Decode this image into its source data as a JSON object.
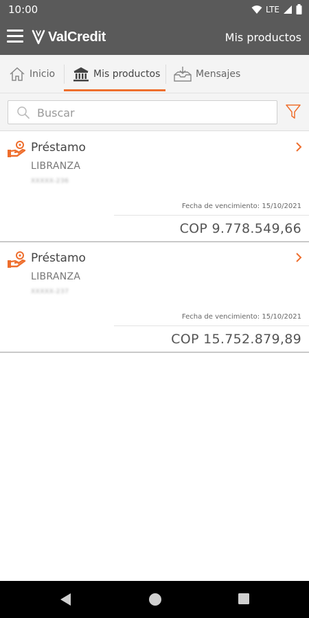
{
  "status_bar": {
    "time": "10:00",
    "network": "LTE"
  },
  "app_bar": {
    "brand": "ValCredit",
    "title": "Mis productos"
  },
  "tabs": [
    {
      "label": "Inicio",
      "icon": "home-icon",
      "active": false
    },
    {
      "label": "Mis productos",
      "icon": "bank-icon",
      "active": true
    },
    {
      "label": "Mensajes",
      "icon": "inbox-icon",
      "active": false
    }
  ],
  "search": {
    "placeholder": "Buscar"
  },
  "products": [
    {
      "title": "Préstamo",
      "subtitle": "LIBRANZA",
      "account": "XXXXX-236",
      "due_label": "Fecha de vencimiento: 15/10/2021",
      "amount": "COP 9.778.549,66"
    },
    {
      "title": "Préstamo",
      "subtitle": "LIBRANZA",
      "account": "XXXXX-237",
      "due_label": "Fecha de vencimiento: 15/10/2021",
      "amount": "COP 15.752.879,89"
    }
  ],
  "colors": {
    "accent": "#ee6e2d",
    "header": "#5a5a5a"
  }
}
